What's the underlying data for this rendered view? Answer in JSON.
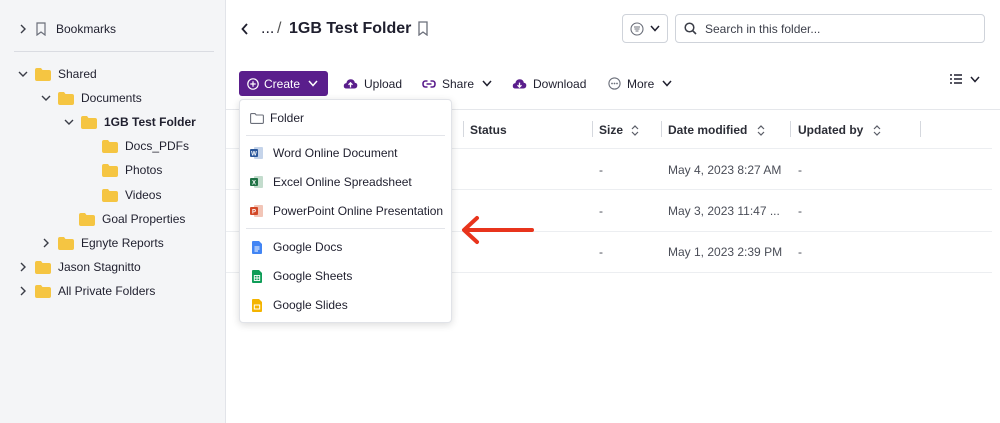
{
  "colors": {
    "brand_purple": "#5a1e8c",
    "folder_yellow": "#f5c542",
    "annotation_red": "#e8341c",
    "word_blue": "#2b579a",
    "excel_green": "#217346",
    "powerpoint_red": "#d24726",
    "gdocs_blue": "#4285f4",
    "gsheets_green": "#0f9d58",
    "gslides_yellow": "#f4b400"
  },
  "sidebar": {
    "bookmarks": {
      "label": "Bookmarks",
      "icon": "bookmark-icon"
    },
    "tree": [
      {
        "label": "Shared",
        "expanded": true
      },
      {
        "label": "Documents",
        "expanded": true
      },
      {
        "label": "1GB Test Folder",
        "expanded": true,
        "selected": true
      },
      {
        "label": "Docs_PDFs"
      },
      {
        "label": "Photos"
      },
      {
        "label": "Videos"
      },
      {
        "label": "Goal Properties"
      },
      {
        "label": "Egnyte Reports",
        "expanded": false
      },
      {
        "label": "Jason Stagnitto",
        "expanded": false
      },
      {
        "label": "All Private Folders",
        "expanded": false
      }
    ]
  },
  "header": {
    "ellipsis": "...",
    "separator": "/",
    "title": "1GB Test Folder",
    "search_placeholder": "Search in this folder..."
  },
  "toolbar": {
    "create": "Create",
    "upload": "Upload",
    "share": "Share",
    "download": "Download",
    "more": "More"
  },
  "table": {
    "columns": [
      "Status",
      "Size",
      "Date modified",
      "Updated by"
    ],
    "rows": [
      {
        "size": "-",
        "date": "May 4, 2023 8:27 AM",
        "updated_by": "-"
      },
      {
        "size": "-",
        "date": "May 3, 2023 11:47 ...",
        "updated_by": "-"
      },
      {
        "size": "-",
        "date": "May 1, 2023 2:39 PM",
        "updated_by": "-"
      }
    ]
  },
  "create_menu": {
    "folder": "Folder",
    "office": [
      "Word Online Document",
      "Excel Online Spreadsheet",
      "PowerPoint Online Presentation"
    ],
    "google": [
      "Google Docs",
      "Google Sheets",
      "Google Slides"
    ]
  }
}
